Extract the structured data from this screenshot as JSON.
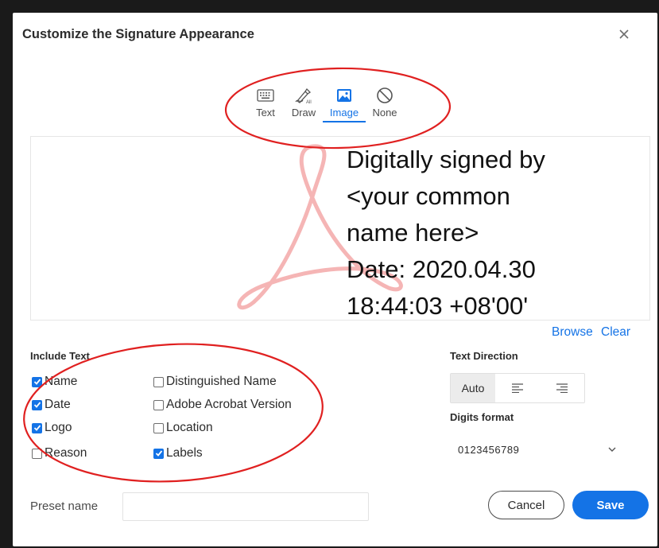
{
  "dialog": {
    "title": "Customize the Signature Appearance"
  },
  "tabs": [
    {
      "label": "Text",
      "icon": "keyboard-icon"
    },
    {
      "label": "Draw",
      "icon": "pen-draw-icon"
    },
    {
      "label": "Image",
      "icon": "image-icon",
      "active": true
    },
    {
      "label": "None",
      "icon": "none-icon"
    }
  ],
  "preview": {
    "lines": [
      "Digitally signed by",
      "<your common",
      "name here>",
      "Date: 2020.04.30",
      "18:44:03 +08'00'"
    ],
    "browse_label": "Browse",
    "clear_label": "Clear"
  },
  "include_text": {
    "title": "Include Text",
    "options": [
      {
        "label": "Name",
        "checked": true
      },
      {
        "label": "Date",
        "checked": true
      },
      {
        "label": "Logo",
        "checked": true
      },
      {
        "label": "Reason",
        "checked": false
      },
      {
        "label": "Distinguished Name",
        "checked": false
      },
      {
        "label": "Adobe Acrobat Version",
        "checked": false
      },
      {
        "label": "Location",
        "checked": false
      },
      {
        "label": "Labels",
        "checked": true
      }
    ]
  },
  "text_direction": {
    "title": "Text Direction",
    "auto_label": "Auto"
  },
  "digits_format": {
    "title": "Digits format",
    "value": "0123456789"
  },
  "preset": {
    "label": "Preset name",
    "value": ""
  },
  "buttons": {
    "cancel": "Cancel",
    "save": "Save"
  },
  "colors": {
    "accent": "#1473e6",
    "annotation": "#e02020",
    "watermark": "#f5b5b5"
  }
}
